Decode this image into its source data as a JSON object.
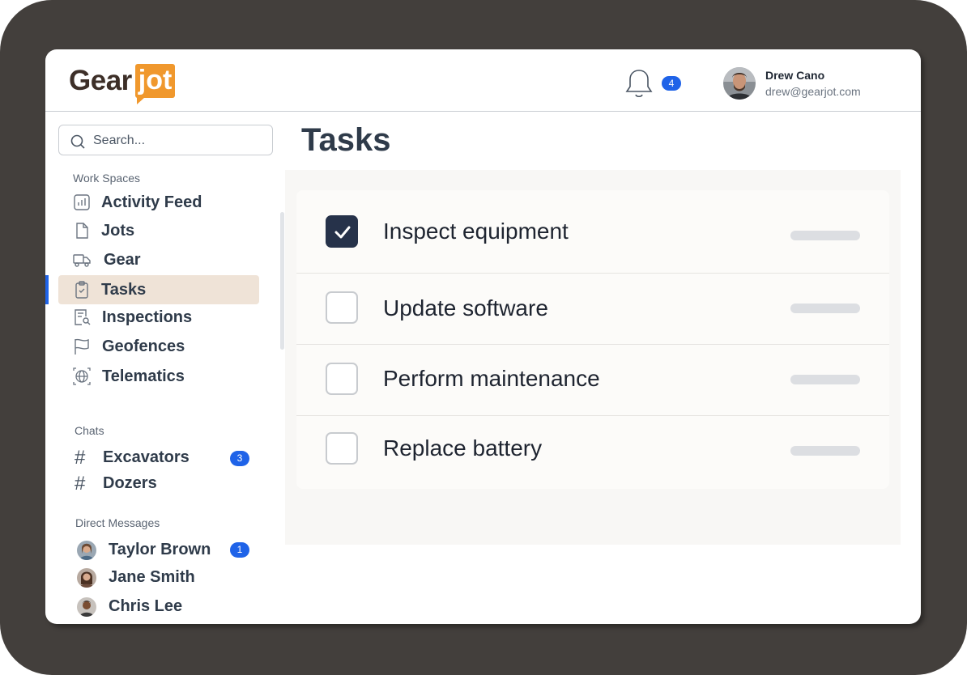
{
  "brand": {
    "part1": "Gear",
    "part2": "jot",
    "accent": "#f0982d"
  },
  "header": {
    "notifications_count": "4",
    "user_name": "Drew Cano",
    "user_email": "drew@gearjot.com"
  },
  "search": {
    "placeholder": "Search..."
  },
  "workspaces": {
    "label": "Work Spaces",
    "items": [
      {
        "label": "Activity Feed",
        "icon": "chart-icon"
      },
      {
        "label": "Jots",
        "icon": "document-icon"
      },
      {
        "label": "Gear",
        "icon": "truck-icon"
      },
      {
        "label": "Tasks",
        "icon": "clipboard-check-icon",
        "active": true
      },
      {
        "label": "Inspections",
        "icon": "inspection-icon"
      },
      {
        "label": "Geofences",
        "icon": "flag-icon"
      },
      {
        "label": "Telematics",
        "icon": "telematics-icon"
      }
    ]
  },
  "chats": {
    "label": "Chats",
    "items": [
      {
        "label": "Excavators",
        "badge": "3"
      },
      {
        "label": "Dozers",
        "badge": ""
      }
    ]
  },
  "direct_messages": {
    "label": "Direct Messages",
    "items": [
      {
        "label": "Taylor Brown",
        "badge": "1"
      },
      {
        "label": "Jane Smith",
        "badge": ""
      },
      {
        "label": "Chris Lee",
        "badge": ""
      }
    ]
  },
  "main": {
    "title": "Tasks",
    "tasks": [
      {
        "label": "Inspect equipment",
        "done": true
      },
      {
        "label": "Update software",
        "done": false
      },
      {
        "label": "Perform maintenance",
        "done": false
      },
      {
        "label": "Replace battery",
        "done": false
      }
    ]
  },
  "colors": {
    "primary": "#1f63e8",
    "checked": "#26324a",
    "active_item": "#efe3d7"
  }
}
